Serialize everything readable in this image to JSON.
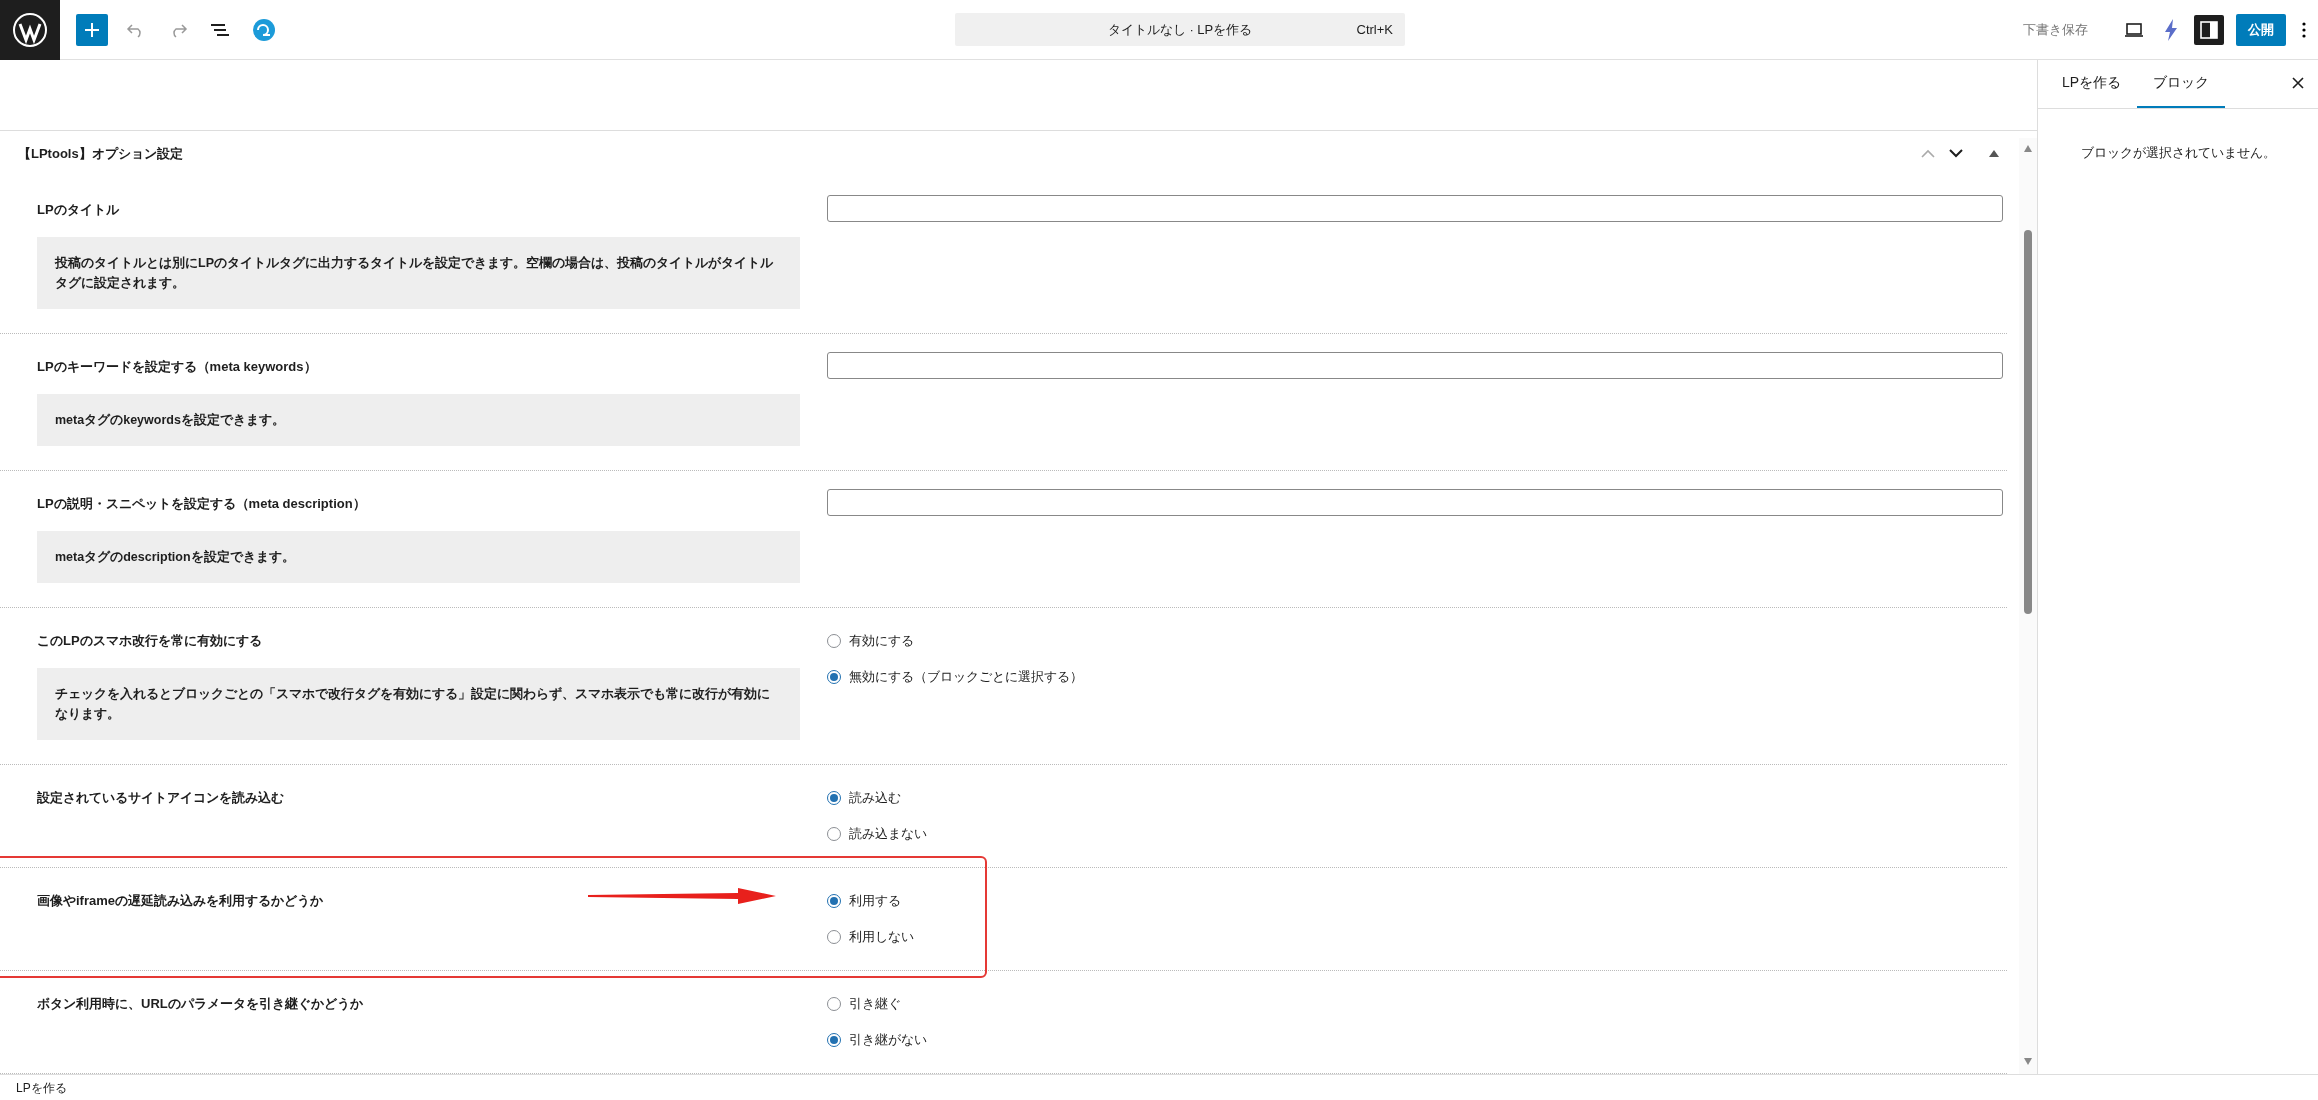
{
  "toolbar": {
    "command_title": "タイトルなし · LPを作る",
    "command_shortcut": "Ctrl+K",
    "save_draft": "下書き保存",
    "publish": "公開",
    "sidebar_toggle_on": true
  },
  "panel": {
    "title": "【LPtools】オプション設定",
    "rows": [
      {
        "kind": "text",
        "label": "LPのタイトル",
        "description": "投稿のタイトルとは別にLPのタイトルタグに出力するタイトルを設定できます。空欄の場合は、投稿のタイトルがタイトルタグに設定されます。",
        "highlighted": false
      },
      {
        "kind": "text",
        "label": "LPのキーワードを設定する（meta keywords）",
        "description": "metaタグのkeywordsを設定できます。",
        "highlighted": false
      },
      {
        "kind": "text",
        "label": "LPの説明・スニペットを設定する（meta description）",
        "description": "metaタグのdescriptionを設定できます。",
        "highlighted": false
      },
      {
        "kind": "radio",
        "label": "このLPのスマホ改行を常に有効にする",
        "description": "チェックを入れるとブロックごとの「スマホで改行タグを有効にする」設定に関わらず、スマホ表示でも常に改行が有効になります。",
        "highlighted": false,
        "options": [
          {
            "label": "有効にする",
            "selected": false
          },
          {
            "label": "無効にする（ブロックごとに選択する）",
            "selected": true
          }
        ]
      },
      {
        "kind": "radio",
        "label": "設定されているサイトアイコンを読み込む",
        "highlighted": false,
        "options": [
          {
            "label": "読み込む",
            "selected": true
          },
          {
            "label": "読み込まない",
            "selected": false
          }
        ]
      },
      {
        "kind": "radio",
        "label": "画像やiframeの遅延読み込みを利用するかどうか",
        "highlighted": true,
        "options": [
          {
            "label": "利用する",
            "selected": true
          },
          {
            "label": "利用しない",
            "selected": false
          }
        ]
      },
      {
        "kind": "radio",
        "label": "ボタン利用時に、URLのパラメータを引き継ぐかどうか",
        "highlighted": false,
        "options": [
          {
            "label": "引き継ぐ",
            "selected": false
          },
          {
            "label": "引き継がない",
            "selected": true
          }
        ]
      }
    ]
  },
  "sidebar": {
    "tabs": [
      {
        "label": "LPを作る",
        "selected": false
      },
      {
        "label": "ブロック",
        "selected": true
      }
    ],
    "empty_message": "ブロックが選択されていません。"
  },
  "status_bar": "LPを作る"
}
